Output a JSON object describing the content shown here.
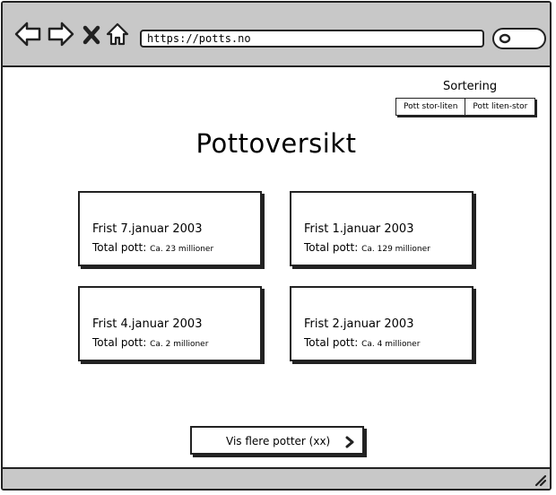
{
  "browser": {
    "url": "https://potts.no",
    "icons": [
      "back-arrow-icon",
      "forward-arrow-icon",
      "close-icon",
      "home-icon",
      "search-icon",
      "resize-grip-icon"
    ]
  },
  "sort": {
    "label": "Sortering",
    "options": [
      "Pott stor-liten",
      "Pott liten-stor"
    ]
  },
  "page": {
    "title": "Pottoversikt"
  },
  "pots": [
    {
      "deadline": "Frist 7.januar 2003",
      "pot_label": "Total pott:",
      "amount": "Ca. 23 millioner"
    },
    {
      "deadline": "Frist 1.januar 2003",
      "pot_label": "Total pott:",
      "amount": "Ca. 129 millioner"
    },
    {
      "deadline": "Frist 4.januar 2003",
      "pot_label": "Total pott:",
      "amount": "Ca. 2 millioner"
    },
    {
      "deadline": "Frist 2.januar 2003",
      "pot_label": "Total pott:",
      "amount": "Ca. 4 millioner"
    }
  ],
  "more": {
    "label": "Vis flere potter (xx)"
  }
}
